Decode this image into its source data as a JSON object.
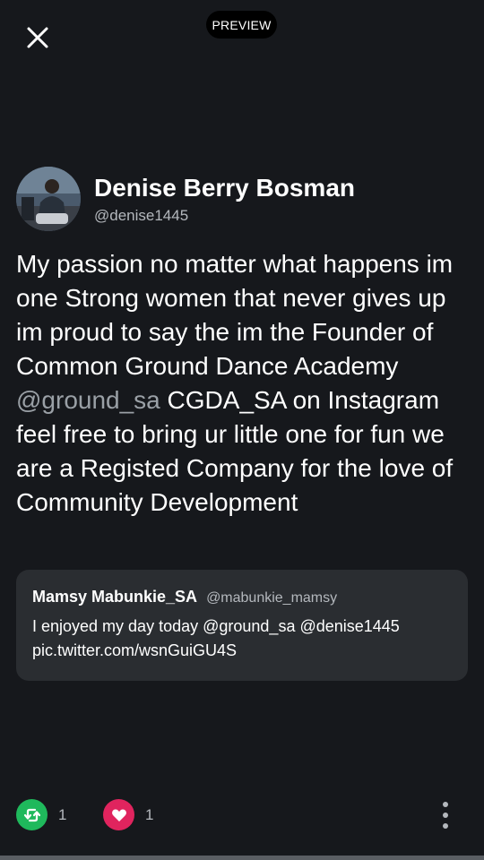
{
  "preview_label": "PREVIEW",
  "tweet": {
    "author_name": "Denise Berry Bosman",
    "author_handle": "@denise1445",
    "text_before_mention": "My passion no matter what happens im one Strong women that never gives up im proud to say the im the Founder of Common Ground Dance Academy ",
    "mention": "@ground_sa",
    "text_after_mention": " CGDA_SA on Instagram feel free to bring ur little one for fun we are a Registed Company for the love of Community Development"
  },
  "quote": {
    "author_name": "Mamsy Mabunkie_SA",
    "author_handle": "@mabunkie_mamsy",
    "text": "I enjoyed my day today @ground_sa @denise1445 pic.twitter.com/wsnGuiGU4S"
  },
  "actions": {
    "retweet_count": "1",
    "like_count": "1"
  },
  "colors": {
    "background": "#16181c",
    "retweet": "#1fb95c",
    "like": "#e0245e",
    "quote_card": "#2a2d31",
    "secondary_text": "#b4b8bd"
  },
  "icons": {
    "close": "close-icon",
    "retweet": "retweet-icon",
    "like": "heart-icon",
    "more": "more-vertical-icon"
  }
}
